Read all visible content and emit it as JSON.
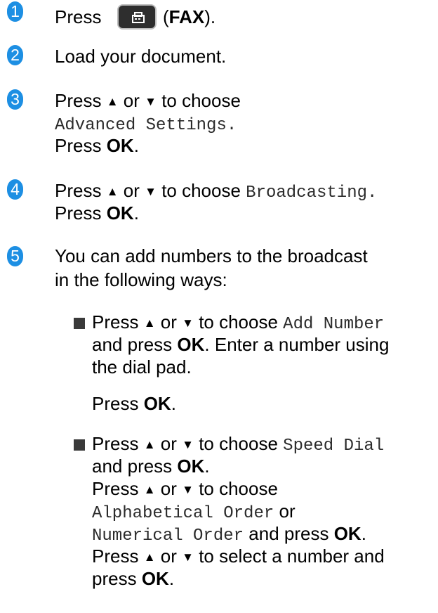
{
  "steps": [
    {
      "number": "1",
      "press": "Press",
      "fax_label": "FAX"
    },
    {
      "number": "2",
      "text": "Load your document."
    },
    {
      "number": "3",
      "prefix": "Press",
      "up": "▲",
      "or": "or",
      "down": "▼",
      "suffix": "to choose",
      "option": "Advanced Settings",
      "period": ".",
      "press": "Press",
      "ok": "OK"
    },
    {
      "number": "4",
      "prefix": "Press",
      "up": "▲",
      "or": "or",
      "down": "▼",
      "suffix": "to choose",
      "option": "Broadcasting",
      "period": ".",
      "press": "Press",
      "ok": "OK"
    },
    {
      "number": "5",
      "line1": "You can add numbers to the broadcast",
      "line2": "in the following ways:"
    }
  ],
  "bullets": [
    {
      "press": "Press",
      "up": "▲",
      "or": "or",
      "down": "▼",
      "choose": "to choose",
      "option": "Add Number",
      "and_press": "and press",
      "ok": "OK",
      "enter": ". Enter a number using",
      "dial": "the dial pad.",
      "press2": "Press",
      "ok2": "OK"
    },
    {
      "press": "Press",
      "up": "▲",
      "or": "or",
      "down": "▼",
      "choose": "to choose",
      "option": "Speed Dial",
      "and_press": "and press",
      "ok": "OK",
      "press2": "Press",
      "choose2": "to choose",
      "opt_a": "Alphabetical Order",
      "or_word": "or",
      "opt_b": "Numerical Order",
      "and_press2": "and press",
      "ok2": "OK",
      "press3": "Press",
      "select": "to select a number and",
      "press_last": "press",
      "ok3": "OK"
    }
  ]
}
